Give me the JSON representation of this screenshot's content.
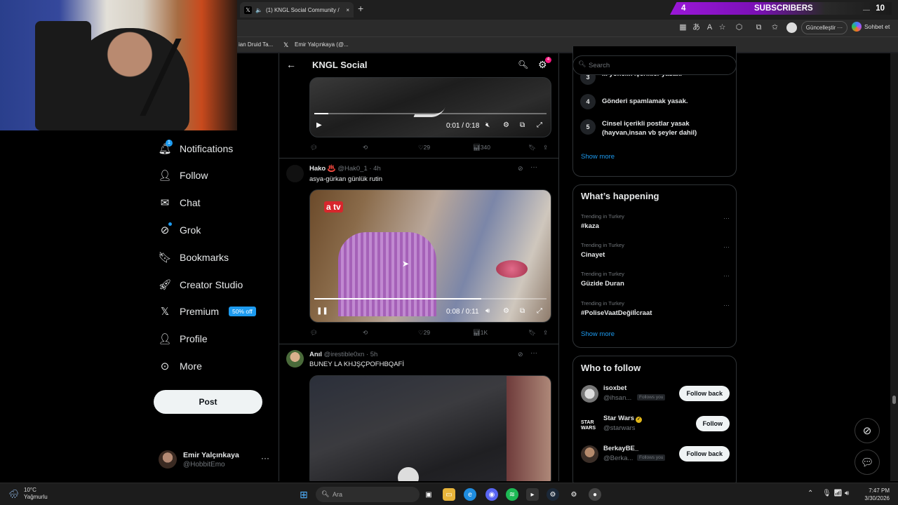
{
  "browser": {
    "tab_title": "(1) KNGL Social Community /",
    "tab_close": "×",
    "new_tab": "+",
    "update_button": "Güncelleştir ···",
    "chat_button": "Sohbet et",
    "bookmarks": [
      "ian Druid Ta...",
      "Emir Yalçınkaya (@..."
    ]
  },
  "overlay": {
    "subs_count": "4",
    "subs_label": "SUBSCRIBERS",
    "subs_goal": "10"
  },
  "nav": {
    "notifications": "Notifications",
    "notifications_badge": "1",
    "follow": "Follow",
    "chat": "Chat",
    "grok": "Grok",
    "bookmarks": "Bookmarks",
    "creator_studio": "Creator Studio",
    "premium": "Premium",
    "premium_badge": "50% off",
    "profile": "Profile",
    "more": "More",
    "post": "Post"
  },
  "account": {
    "name": "Emir Yalçınkaya",
    "handle": "@HobbitEmo",
    "more": "···"
  },
  "feed": {
    "title": "KNGL Social",
    "settings_badge": "4",
    "posts": [
      {
        "video_time": "0:01 / 0:18",
        "progress": 0.06,
        "replies": "",
        "reposts": "",
        "likes": "29",
        "views": "340"
      },
      {
        "name": "Hako ♨️",
        "handle": "@Hak0_1 · 4h",
        "text": "asya-gürkan günlük rutin",
        "video_time": "0:08 / 0:11",
        "progress": 0.72,
        "watermark": "a tv",
        "likes": "29",
        "views": "1K"
      },
      {
        "name": "Anıl",
        "handle": "@irestible0xn · 5h",
        "text": "BUNEY LA KHJŞÇPOFHBQAFİ"
      }
    ]
  },
  "sidebar": {
    "search_placeholder": "Search",
    "rules": [
      {
        "num": "3",
        "text": "... yönelik içerikler yasak."
      },
      {
        "num": "4",
        "text": "Gönderi spamlamak yasak."
      },
      {
        "num": "5",
        "text": "Cinsel içerikli postlar yasak (hayvan,insan vb şeyler dahil)"
      }
    ],
    "rules_show_more": "Show more",
    "happening_title": "What’s happening",
    "trends": [
      {
        "context": "Trending in Turkey",
        "topic": "#kaza"
      },
      {
        "context": "Trending in Turkey",
        "topic": "Cinayet"
      },
      {
        "context": "Trending in Turkey",
        "topic": "Güzide Duran"
      },
      {
        "context": "Trending in Turkey",
        "topic": "#PoliseVaatDeğilİcraat"
      }
    ],
    "trends_show_more": "Show more",
    "who_to_follow_title": "Who to follow",
    "suggestions": [
      {
        "name": "isoxbet",
        "handle": "@ihsan...",
        "follows_you": "Follows you",
        "button": "Follow back"
      },
      {
        "name": "Star Wars",
        "handle": "@starwars",
        "follows_you": "",
        "button": "Follow"
      },
      {
        "name": "BerkayBE_",
        "handle": "@Berka...",
        "follows_you": "Follows you",
        "button": "Follow back"
      }
    ]
  },
  "taskbar": {
    "temp": "10°C",
    "weather": "Yağmurlu",
    "search": "Ara",
    "time": "7:47 PM",
    "date": "3/30/2026"
  },
  "colors": {
    "accent": "#1d9bf0",
    "background": "#000000",
    "overlay_purple": "#9a17d8"
  }
}
